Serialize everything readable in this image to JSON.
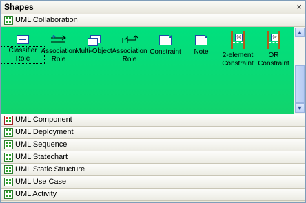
{
  "window": {
    "title": "Shapes",
    "close_glyph": "×"
  },
  "active_section": {
    "label": "UML Collaboration",
    "icon": "stencil-icon"
  },
  "shapes": [
    {
      "label_line1": "Classifier",
      "label_line2": "Role",
      "icon": "classifier-role-icon"
    },
    {
      "label_line1": "Association",
      "label_line2": "Role",
      "icon": "association-role-icon"
    },
    {
      "label_line1": "Multi-Object",
      "label_line2": "",
      "icon": "multi-object-icon"
    },
    {
      "label_line1": "Association",
      "label_line2": "Role",
      "icon": "association-role-2-icon"
    },
    {
      "label_line1": "Constraint",
      "label_line2": "",
      "icon": "constraint-icon"
    },
    {
      "label_line1": "Note",
      "label_line2": "",
      "icon": "note-icon"
    },
    {
      "label_line1": "2-element",
      "label_line2": "Constraint",
      "icon": "two-element-constraint-icon"
    },
    {
      "label_line1": "OR",
      "label_line2": "Constraint",
      "icon": "or-constraint-icon"
    }
  ],
  "sections": [
    {
      "label": "UML Component"
    },
    {
      "label": "UML Deployment"
    },
    {
      "label": "UML Sequence"
    },
    {
      "label": "UML Statechart"
    },
    {
      "label": "UML Static Structure"
    },
    {
      "label": "UML Use Case"
    },
    {
      "label": "UML Activity"
    }
  ],
  "scrollbar": {
    "up": "▲",
    "down": "▼"
  },
  "colors": {
    "palette_bg": "#00e07e",
    "chrome": "#ece9d8",
    "accent": "#2047a8"
  }
}
